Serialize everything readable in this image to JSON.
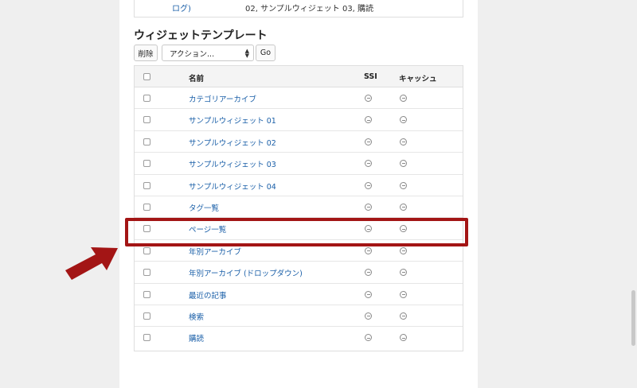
{
  "top_row": {
    "link_text": "ログ)",
    "text": "02, サンプルウィジェット 03, 購読"
  },
  "section": {
    "title": "ウィジェットテンプレート"
  },
  "toolbar": {
    "delete_label": "削除",
    "action_select_value": "アクション...",
    "go_label": "Go"
  },
  "table": {
    "headers": {
      "name": "名前",
      "ssi": "SSI",
      "cache": "キャッシュ"
    },
    "rows": [
      {
        "name": "カテゴリアーカイブ"
      },
      {
        "name": "サンプルウィジェット 01"
      },
      {
        "name": "サンプルウィジェット 02"
      },
      {
        "name": "サンプルウィジェット 03"
      },
      {
        "name": "サンプルウィジェット 04"
      },
      {
        "name": "タグ一覧"
      },
      {
        "name": "ページ一覧"
      },
      {
        "name": "年別アーカイブ"
      },
      {
        "name": "年別アーカイブ (ドロップダウン)"
      },
      {
        "name": "最近の記事"
      },
      {
        "name": "検索"
      },
      {
        "name": "購読"
      }
    ],
    "highlighted_row": "ページ一覧"
  },
  "colors": {
    "link": "#1a5fa8",
    "highlight": "#a31515",
    "arrow": "#a31515"
  },
  "icons": {
    "ssi_status": "minus-circle-icon",
    "cache_status": "minus-circle-icon",
    "select_caret": "up-down-caret-icon",
    "pointer": "arrow-icon"
  }
}
